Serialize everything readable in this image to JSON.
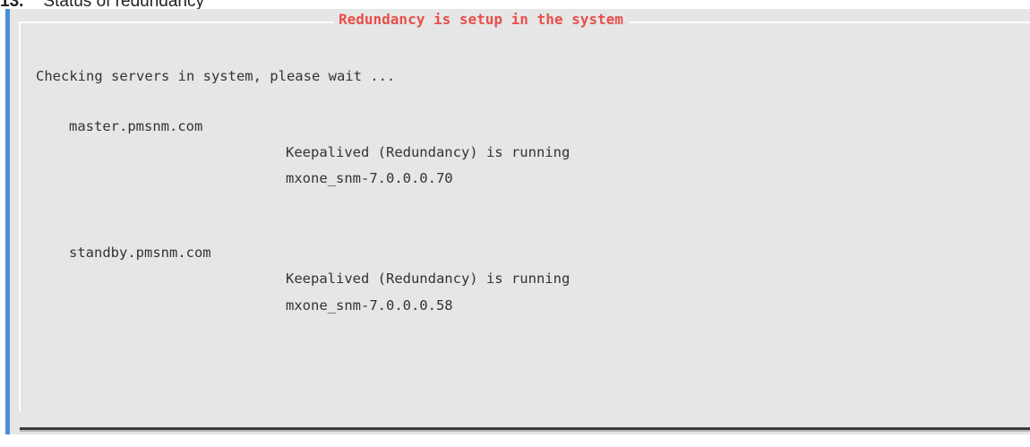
{
  "caption": {
    "number": "13.",
    "text": "Status of redundancy"
  },
  "dialog": {
    "title": "Redundancy is setup in the system",
    "checking_message": "Checking servers in system, please wait ...",
    "servers": [
      {
        "hostname": "master.pmsnm.com",
        "status": "Keepalived (Redundancy) is running",
        "version": "mxone_snm-7.0.0.0.70"
      },
      {
        "hostname": "standby.pmsnm.com",
        "status": "Keepalived (Redundancy) is running",
        "version": "mxone_snm-7.0.0.0.58"
      }
    ]
  },
  "colors": {
    "title_red": "#e8504a",
    "panel_gray": "#e6e6e6",
    "text_dark": "#333333",
    "edge_blue": "#4a8fd6"
  }
}
